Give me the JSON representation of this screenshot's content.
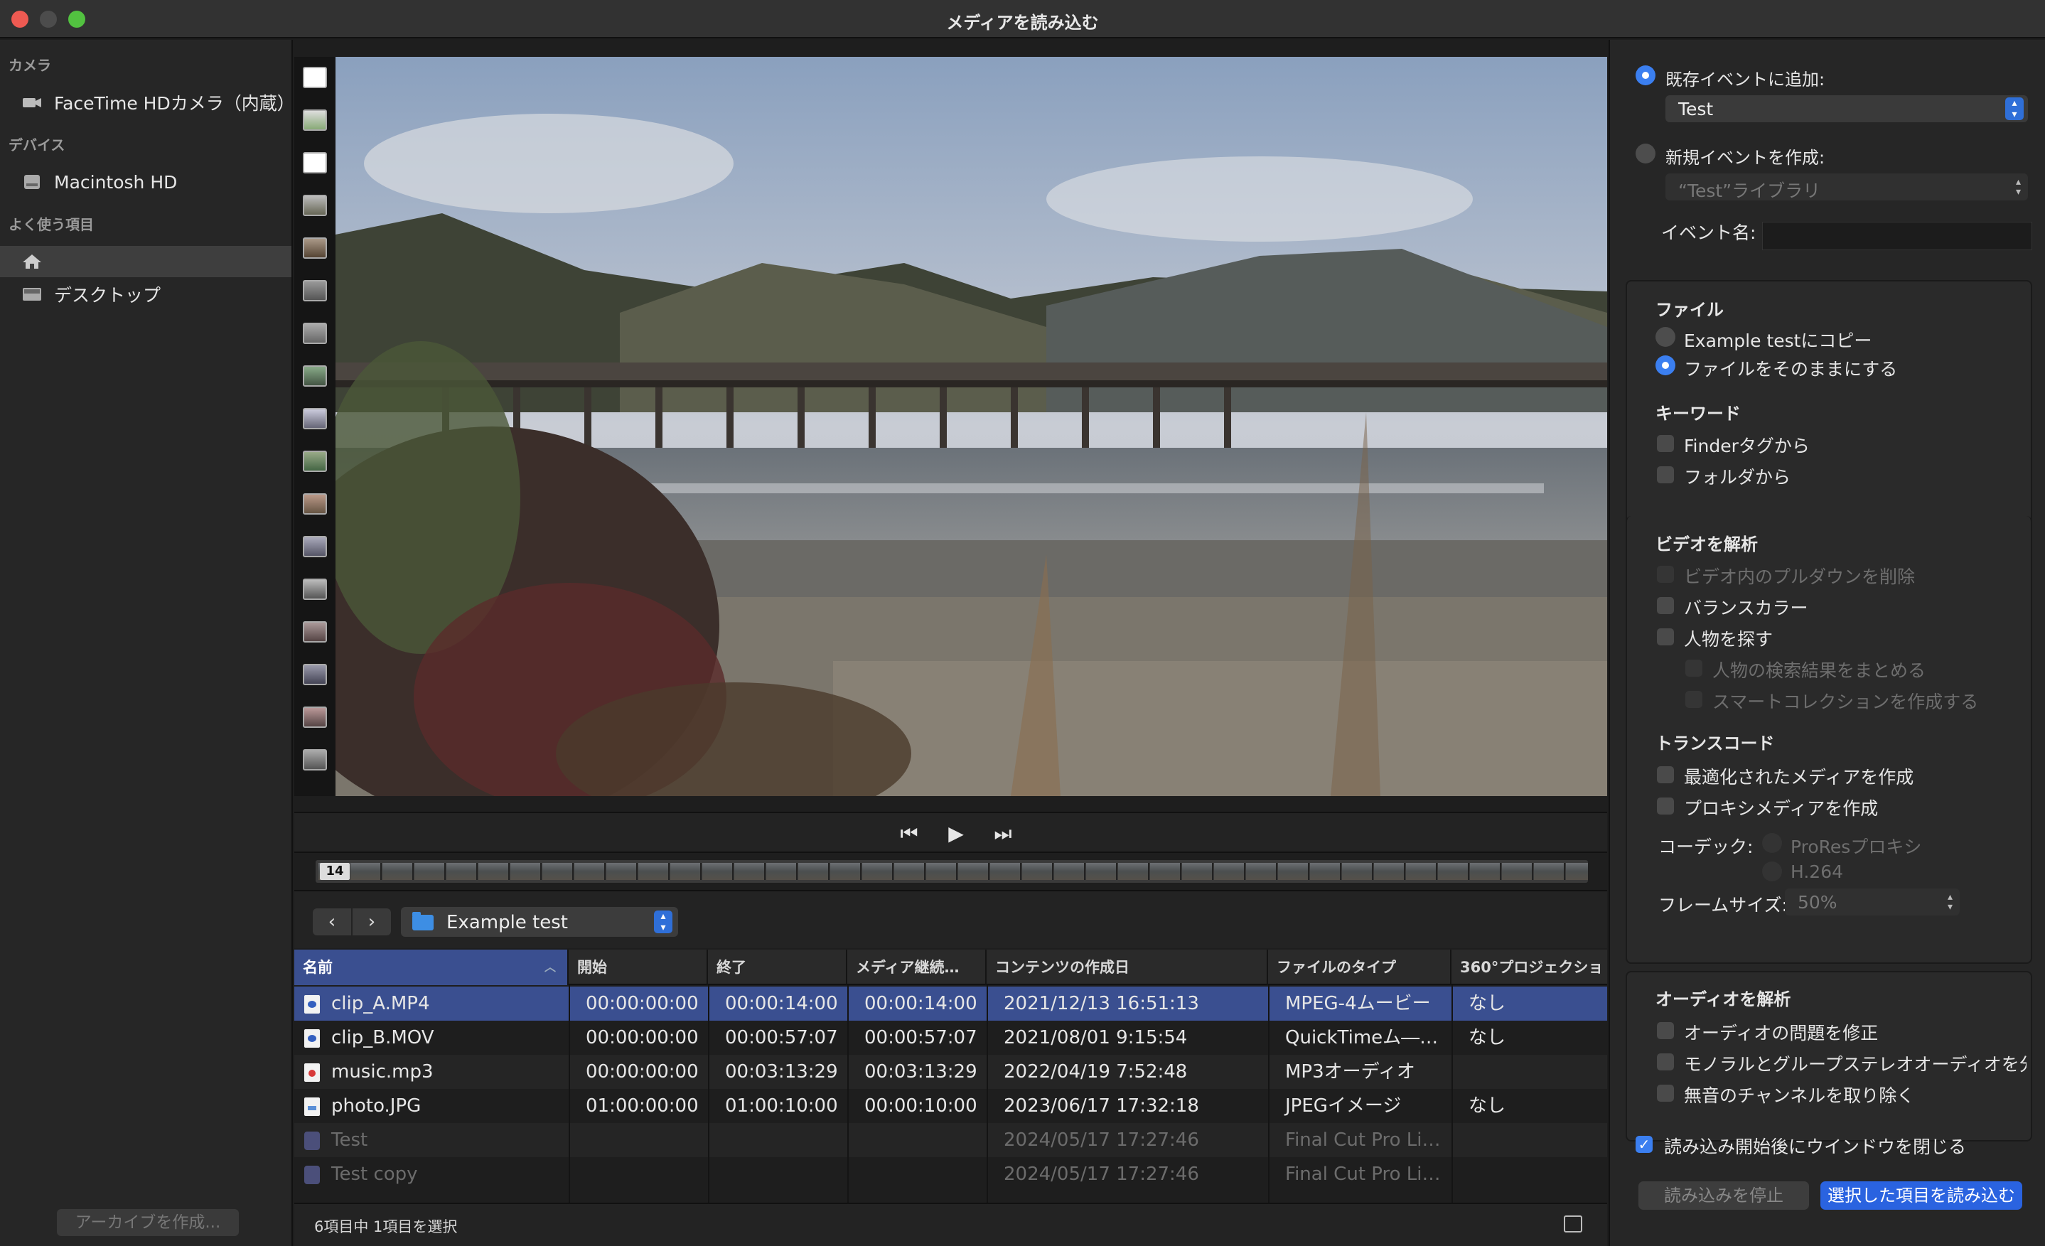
{
  "window": {
    "title": "メディアを読み込む"
  },
  "sidebar": {
    "camera_header": "カメラ",
    "camera_item": "FaceTime HDカメラ（内蔵）",
    "devices_header": "デバイス",
    "device_item": "Macintosh HD",
    "favorites_header": "よく使う項目",
    "favorite_desktop": "デスクトップ",
    "archive_button": "アーカイブを作成..."
  },
  "timeline": {
    "marker": "14"
  },
  "folder": {
    "selected": "Example test"
  },
  "table": {
    "columns": [
      "名前",
      "開始",
      "終了",
      "メディア継続…",
      "コンテンツの作成日",
      "ファイルのタイプ",
      "360°プロジェクショ"
    ],
    "rows": [
      {
        "name": "clip_A.MP4",
        "start": "00:00:00:00",
        "end": "00:00:14:00",
        "duration": "00:00:14:00",
        "created": "2021/12/13 16:51:13",
        "type": "MPEG-4ムービー",
        "proj360": "なし",
        "icon": "video-file-icon"
      },
      {
        "name": "clip_B.MOV",
        "start": "00:00:00:00",
        "end": "00:00:57:07",
        "duration": "00:00:57:07",
        "created": "2021/08/01 9:15:54",
        "type": "QuickTimeム―…",
        "proj360": "なし",
        "icon": "video-file-icon"
      },
      {
        "name": "music.mp3",
        "start": "00:00:00:00",
        "end": "00:03:13:29",
        "duration": "00:03:13:29",
        "created": "2022/04/19 7:52:48",
        "type": "MP3オーディオ",
        "proj360": "",
        "icon": "audio-file-icon"
      },
      {
        "name": "photo.JPG",
        "start": "01:00:00:00",
        "end": "01:00:10:00",
        "duration": "00:00:10:00",
        "created": "2023/06/17 17:32:18",
        "type": "JPEGイメージ",
        "proj360": "なし",
        "icon": "image-file-icon"
      },
      {
        "name": "Test",
        "start": "",
        "end": "",
        "duration": "",
        "created": "2024/05/17 17:27:46",
        "type": "Final Cut Pro Li…",
        "proj360": "",
        "icon": "library-icon"
      },
      {
        "name": "Test copy",
        "start": "",
        "end": "",
        "duration": "",
        "created": "2024/05/17 17:27:46",
        "type": "Final Cut Pro Li…",
        "proj360": "",
        "icon": "library-icon"
      }
    ]
  },
  "status": {
    "text": "6項目中 1項目を選択"
  },
  "right": {
    "add_existing": "既存イベントに追加:",
    "existing_event": "Test",
    "create_new": "新規イベントを作成:",
    "new_library": "“Test”ライブラリ",
    "event_name_label": "イベント名:",
    "files_header": "ファイル",
    "copy_option": "Example testにコピー",
    "leave_option": "ファイルをそのままにする",
    "keywords_header": "キーワード",
    "kw_finder": "Finderタグから",
    "kw_folder": "フォルダから",
    "analyze_video_header": "ビデオを解析",
    "remove_pulldown": "ビデオ内のプルダウンを削除",
    "balance_color": "バランスカラー",
    "find_people": "人物を探す",
    "consolidate_people": "人物の検索結果をまとめる",
    "smart_collections": "スマートコレクションを作成する",
    "transcode_header": "トランスコード",
    "optimized_media": "最適化されたメディアを作成",
    "proxy_media": "プロキシメディアを作成",
    "codec_label": "コーデック:",
    "codec_prores": "ProResプロキシ",
    "codec_h264": "H.264",
    "frame_size_label": "フレームサイズ:",
    "frame_size": "50%",
    "analyze_audio_header": "オーディオを解析",
    "fix_audio": "オーディオの問題を修正",
    "separate_mono": "モノラルとグループステレオオーディオを分離",
    "remove_silent": "無音のチャンネルを取り除く",
    "close_window": "読み込み開始後にウインドウを閉じる",
    "stop_import": "読み込みを停止",
    "import_selected": "選択した項目を読み込む"
  }
}
